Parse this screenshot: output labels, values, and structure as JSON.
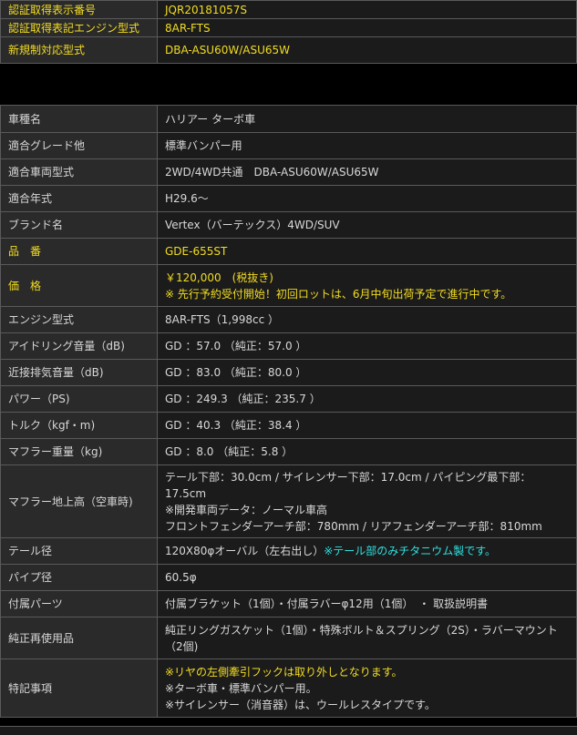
{
  "top": {
    "cert_number_label": "認証取得表示番号",
    "cert_number_value": "JQR20181057S",
    "cert_engine_label": "認証取得表記エンジン型式",
    "cert_engine_value": "8AR-FTS",
    "new_regulation_label": "新規制対応型式",
    "new_regulation_value": "DBA-ASU60W/ASU65W"
  },
  "specs": {
    "model_label": "車種名",
    "model_value": "ハリアー ターボ車",
    "grade_label": "適合グレード他",
    "grade_value": "標準バンパー用",
    "vehicle_type_label": "適合車両型式",
    "vehicle_type_value": "2WD/4WD共通　DBA-ASU60W/ASU65W",
    "year_label": "適合年式",
    "year_value": "H29.6～",
    "brand_label": "ブランド名",
    "brand_value": "Vertex（バーテックス）4WD/SUV",
    "part_no_label": "品　番",
    "part_no_value": "GDE-655ST",
    "price_label": "価　格",
    "price_value": "￥120,000　(税抜き)",
    "price_note": "※ 先行予約受付開始！初回ロットは、6月中旬出荷予定で進行中です。",
    "engine_label": "エンジン型式",
    "engine_value": "8AR-FTS（1,998cc ）",
    "idle_label": "アイドリング音量（dB)",
    "idle_value": "GD ：57.0 （純正：57.0 ）",
    "exhaust_label": "近接排気音量（dB)",
    "exhaust_value": "GD ：83.0 （純正：80.0 ）",
    "power_label": "パワー（PS)",
    "power_value": "GD ：249.3 （純正：235.7 ）",
    "torque_label": "トルク（kgf・m)",
    "torque_value": "GD ：40.3 （純正：38.4 ）",
    "weight_label": "マフラー重量（kg)",
    "weight_value": "GD ：8.0 （純正：5.8 ）",
    "clearance_label": "マフラー地上高（空車時)",
    "clearance_line1": "テール下部：30.0cm / サイレンサー下部：17.0cm / パイピング最下部：",
    "clearance_line2": "17.5cm",
    "clearance_line3": "※開発車両データ：ノーマル車高",
    "clearance_line4": "フロントフェンダーアーチ部：780mm / リアフェンダーアーチ部：810mm",
    "tail_label": "テール径",
    "tail_value": "120X80φオーバル（左右出し）",
    "tail_note": "※テール部のみチタニウム製です。",
    "pipe_label": "パイプ径",
    "pipe_value": "60.5φ",
    "parts_label": "付属パーツ",
    "parts_value": "付属ブラケット（1個）・付属ラバーφ12用（1個）　・ 取扱説明書",
    "reuse_label": "純正再使用品",
    "reuse_value": "純正リングガスケット（1個）・特殊ボルト＆スプリング（2S）・ラバーマウント（2個)",
    "notes_label": "特記事項",
    "notes_line1": "※リヤの左側牽引フックは取り外しとなります。",
    "notes_line2": "※ターボ車・標準バンパー用。",
    "notes_line3": "※サイレンサー（消音器）は、ウールレスタイプです。"
  }
}
